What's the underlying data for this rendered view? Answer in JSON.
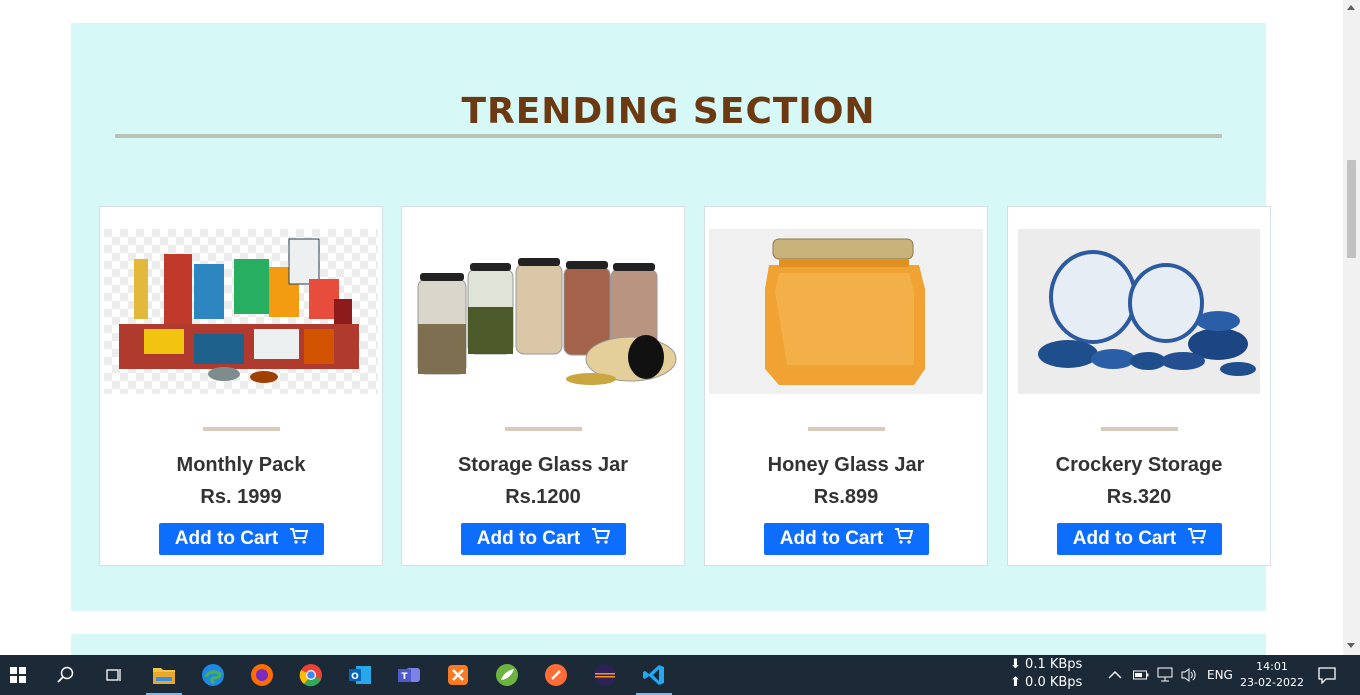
{
  "section": {
    "title": "TRENDING SECTION",
    "background": "#d6f8f7",
    "title_color": "#6b3a12"
  },
  "products": [
    {
      "name": "Monthly Pack",
      "price": "Rs. 1999",
      "button": "Add to Cart",
      "image": "grocery-bundle"
    },
    {
      "name": "Storage Glass Jar",
      "price": "Rs.1200",
      "button": "Add to Cart",
      "image": "glass-jars"
    },
    {
      "name": "Honey Glass Jar",
      "price": "Rs.899",
      "button": "Add to Cart",
      "image": "honey-jar"
    },
    {
      "name": "Crockery Storage",
      "price": "Rs.320",
      "button": "Add to Cart",
      "image": "blue-crockery"
    }
  ],
  "button_color": "#0d6efd",
  "taskbar": {
    "net_down": "0.1 KBps",
    "net_up": "0.0 KBps",
    "language": "ENG",
    "time": "14:01",
    "date": "23-02-2022",
    "apps": [
      "windows-start-icon",
      "search-icon",
      "task-view-icon",
      "file-explorer-icon",
      "edge-icon",
      "firefox-icon",
      "chrome-icon",
      "outlook-icon",
      "teams-icon",
      "xampp-icon",
      "spring-icon",
      "postman-icon",
      "eclipse-icon",
      "vscode-icon"
    ]
  }
}
